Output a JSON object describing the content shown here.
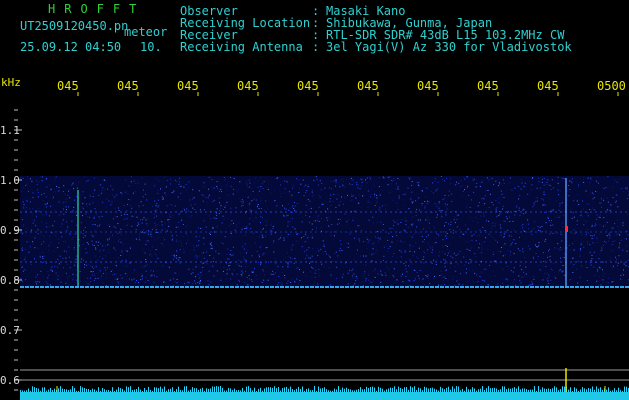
{
  "header": {
    "app_title": "HROFFT",
    "file_name": "UT2509120450.pn",
    "meteor_label": "meteor",
    "date_time": "25.09.12 04:50",
    "count": "10."
  },
  "station_info": [
    {
      "key": "Observer",
      "value": "Masaki Kano"
    },
    {
      "key": "Receiving Location",
      "value": "Shibukawa, Gunma, Japan"
    },
    {
      "key": "Receiver",
      "value": "RTL-SDR SDR# 43dB L15 103.2MHz CW"
    },
    {
      "key": "Receiving Antenna",
      "value": "3el Yagi(V) Az 330 for Vladivostok"
    }
  ],
  "separator": ":",
  "plot": {
    "unit_label": "kHz",
    "time_labels": [
      "045",
      "045",
      "045",
      "045",
      "045",
      "045",
      "045",
      "045",
      "045",
      "0500"
    ],
    "freq_labels": [
      "1.1",
      "1.0",
      "0.9",
      "0.8",
      "0.7",
      "0.6"
    ]
  },
  "colors": {
    "background": "#000000",
    "title_green": "#2fd03a",
    "text_cyan": "#2fd0d0",
    "label_yellow": "#e6e600",
    "signal_blue": "#1a3cff"
  }
}
